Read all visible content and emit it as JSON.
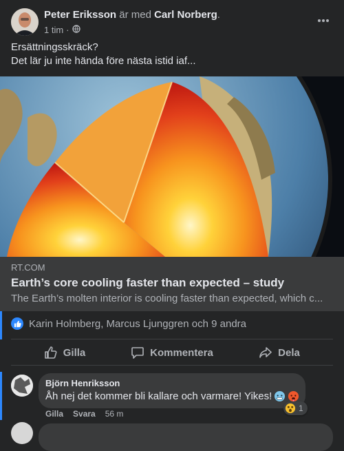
{
  "post": {
    "author": "Peter Eriksson",
    "with_text": "är med",
    "tagged": "Carl Norberg",
    "tagged_suffix": ".",
    "time": "1 tim",
    "separator": "·",
    "audience_icon": "globe-icon",
    "more_icon": "more-horizontal-icon",
    "text_line1": "Ersättningsskräck?",
    "text_line2": "Det lär ju inte hända före nästa istid iaf..."
  },
  "link": {
    "image_subject": "earth-core-cutaway",
    "domain": "RT.COM",
    "title": "Earth’s core cooling faster than expected – study",
    "description": "The Earth’s molten interior is cooling faster than expected, which c..."
  },
  "reactions": {
    "icon": "like-icon",
    "text": "Karin Holmberg, Marcus Ljunggren och 9 andra"
  },
  "actions": {
    "like_label": "Gilla",
    "comment_label": "Kommentera",
    "share_label": "Dela"
  },
  "comment": {
    "author": "Björn Henriksson",
    "text": "Åh nej det kommer bli kallare och varmare! Yikes!",
    "emojis": [
      "cold-face-emoji",
      "hot-face-emoji"
    ],
    "reaction_emoji": "astonished-emoji",
    "reaction_count": "1",
    "like_label": "Gilla",
    "reply_label": "Svara",
    "time": "56 m"
  },
  "colors": {
    "background": "#242526",
    "card": "#3a3b3c",
    "accent": "#2d88ff",
    "text_primary": "#e4e6eb",
    "text_secondary": "#b0b3b8"
  }
}
